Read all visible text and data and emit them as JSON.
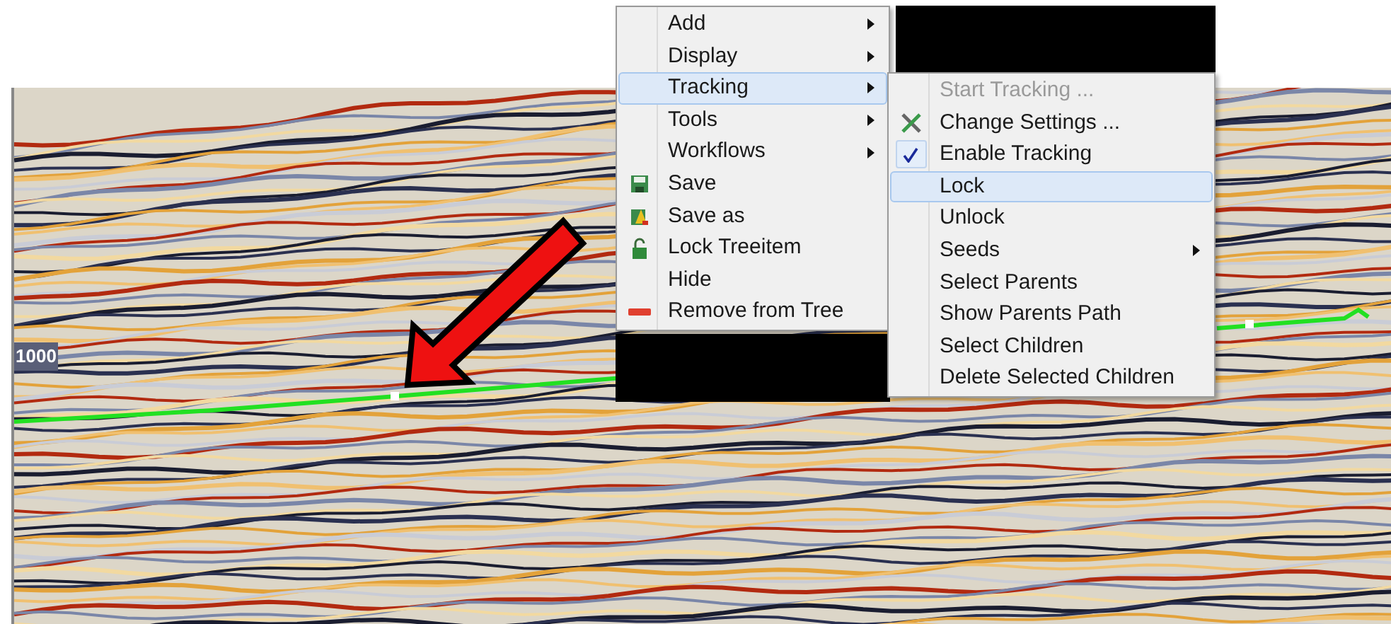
{
  "section": {
    "axis_label": "1000"
  },
  "context_menu": {
    "items": [
      {
        "label": "Add",
        "submenu": true,
        "selected": false
      },
      {
        "label": "Display",
        "submenu": true,
        "selected": false
      },
      {
        "label": "Tracking",
        "submenu": true,
        "selected": true
      },
      {
        "label": "Tools",
        "submenu": true,
        "selected": false
      },
      {
        "label": "Workflows",
        "submenu": true,
        "selected": false
      },
      {
        "label": "Save",
        "submenu": false,
        "selected": false
      },
      {
        "label": "Save as",
        "submenu": false,
        "selected": false
      },
      {
        "label": "Lock Treeitem",
        "submenu": false,
        "selected": false
      },
      {
        "label": "Hide",
        "submenu": false,
        "selected": false
      },
      {
        "label": "Remove from Tree",
        "submenu": false,
        "selected": false
      }
    ]
  },
  "tracking_submenu": {
    "items": [
      {
        "label": "Start Tracking ...",
        "submenu": false,
        "selected": false,
        "disabled": true,
        "checked": false
      },
      {
        "label": "Change Settings ...",
        "submenu": false,
        "selected": false,
        "disabled": false,
        "checked": false
      },
      {
        "label": "Enable Tracking",
        "submenu": false,
        "selected": false,
        "disabled": false,
        "checked": true
      },
      {
        "label": "Lock",
        "submenu": false,
        "selected": true,
        "disabled": false,
        "checked": false
      },
      {
        "label": "Unlock",
        "submenu": false,
        "selected": false,
        "disabled": false,
        "checked": false
      },
      {
        "label": "Seeds",
        "submenu": true,
        "selected": false,
        "disabled": false,
        "checked": false
      },
      {
        "label": "Select Parents",
        "submenu": false,
        "selected": false,
        "disabled": false,
        "checked": false
      },
      {
        "label": "Show Parents Path",
        "submenu": false,
        "selected": false,
        "disabled": false,
        "checked": false
      },
      {
        "label": "Select Children",
        "submenu": false,
        "selected": false,
        "disabled": false,
        "checked": false
      },
      {
        "label": "Delete Selected Children",
        "submenu": false,
        "selected": false,
        "disabled": false,
        "checked": false
      }
    ]
  }
}
